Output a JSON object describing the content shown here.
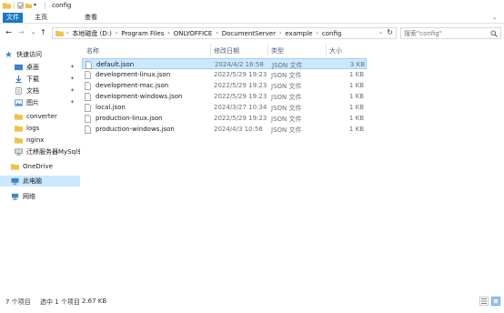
{
  "window": {
    "title": "config"
  },
  "ribbon": {
    "tabs": [
      "文件",
      "主页",
      "查看"
    ]
  },
  "address": {
    "crumbs": [
      "本地磁盘 (D:)",
      "Program Files",
      "ONLYOFFICE",
      "DocumentServer",
      "example",
      "config"
    ]
  },
  "search": {
    "placeholder": "搜索\"config\""
  },
  "nav": {
    "quick_access": "快速访问",
    "items": [
      "桌面",
      "下载",
      "文档",
      "图片",
      "converter",
      "logs",
      "nginx",
      "迁移服务器MySql$"
    ],
    "onedrive": "OneDrive",
    "this_pc": "此电脑",
    "network": "网络"
  },
  "columns": {
    "name": "名称",
    "date": "修改日期",
    "type": "类型",
    "size": "大小"
  },
  "files": [
    {
      "name": "default.json",
      "date": "2024/4/2 16:58",
      "type": "JSON 文件",
      "size": "3 KB",
      "selected": true
    },
    {
      "name": "development-linux.json",
      "date": "2022/5/29 19:23",
      "type": "JSON 文件",
      "size": "1 KB",
      "selected": false
    },
    {
      "name": "development-mac.json",
      "date": "2022/5/29 19:23",
      "type": "JSON 文件",
      "size": "1 KB",
      "selected": false
    },
    {
      "name": "development-windows.json",
      "date": "2022/5/29 19:23",
      "type": "JSON 文件",
      "size": "1 KB",
      "selected": false
    },
    {
      "name": "local.json",
      "date": "2024/3/27 10:34",
      "type": "JSON 文件",
      "size": "1 KB",
      "selected": false
    },
    {
      "name": "production-linux.json",
      "date": "2022/5/29 19:23",
      "type": "JSON 文件",
      "size": "1 KB",
      "selected": false
    },
    {
      "name": "production-windows.json",
      "date": "2024/4/3 10:56",
      "type": "JSON 文件",
      "size": "1 KB",
      "selected": false
    }
  ],
  "status": {
    "item_count": "7 个项目",
    "selected": "选中 1 个项目",
    "size": "2.67 KB"
  },
  "colors": {
    "accent": "#1979ca",
    "selection": "#cce8ff",
    "folder": "#f0c24b",
    "header_text": "#4d6082"
  }
}
